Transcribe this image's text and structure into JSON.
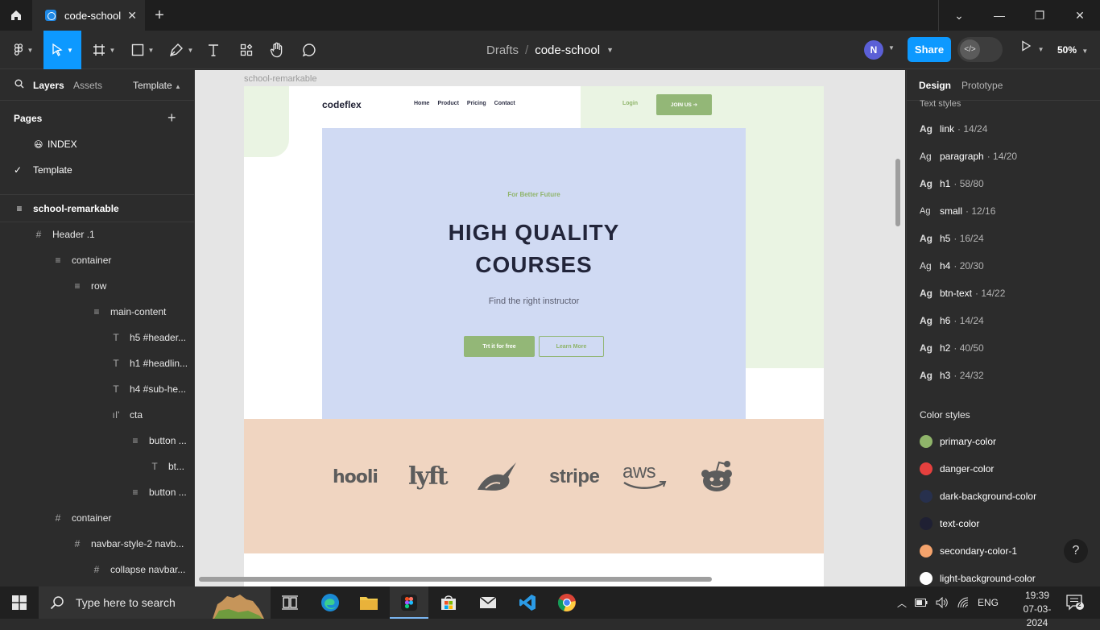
{
  "browser": {
    "tab_title": "code-school",
    "tab_close": "✕",
    "new_tab": "+",
    "win_minimize": "—",
    "win_restore": "❐",
    "win_close": "✕"
  },
  "toolbar": {
    "breadcrumb_parent": "Drafts",
    "breadcrumb_sep": "/",
    "file_name": "code-school",
    "avatar_initial": "N",
    "share_label": "Share",
    "zoom_label": "50%"
  },
  "left_panel": {
    "tabs": [
      "Layers",
      "Assets",
      "Template"
    ],
    "pages_header": "Pages",
    "pages": [
      {
        "emoji": "😃",
        "name": "INDEX"
      },
      {
        "check": "✓",
        "name": "Template"
      }
    ],
    "layers": [
      {
        "name": "school-remarkable",
        "icon": "≡"
      },
      {
        "name": "Header .1",
        "icon": "#"
      },
      {
        "name": "container",
        "icon": "≡"
      },
      {
        "name": "row",
        "icon": "≡"
      },
      {
        "name": "main-content",
        "icon": "≡"
      },
      {
        "name": "h5 #header...",
        "icon": "T"
      },
      {
        "name": "h1 #headlin...",
        "icon": "T"
      },
      {
        "name": "h4 #sub-he...",
        "icon": "T"
      },
      {
        "name": "cta",
        "icon": "ıI'"
      },
      {
        "name": "button ...",
        "icon": "≡"
      },
      {
        "name": "bt...",
        "icon": "T"
      },
      {
        "name": "button ...",
        "icon": "≡"
      },
      {
        "name": "container",
        "icon": "#"
      },
      {
        "name": "navbar-style-2 navb...",
        "icon": "#"
      },
      {
        "name": "collapse navbar...",
        "icon": "#"
      }
    ]
  },
  "canvas": {
    "frame_label": "school-remarkable",
    "site": {
      "logo": "codeflex",
      "nav": [
        "Home",
        "Product",
        "Pricing",
        "Contact"
      ],
      "login": "Login",
      "join": "JOIN US  ➔",
      "hero_tag": "For Better Future",
      "hero_title_line1": "HIGH QUALITY",
      "hero_title_line2": "COURSES",
      "hero_sub": "Find the right instructor",
      "btn_primary": "Trt it for free",
      "btn_secondary": "Learn More",
      "brands": [
        "hooli",
        "lyft",
        "stripe",
        "aws"
      ]
    }
  },
  "right_panel": {
    "tabs": [
      "Design",
      "Prototype"
    ],
    "text_styles_header": "Text styles",
    "text_styles": [
      {
        "ag": "Ag",
        "name": "link",
        "meta": "· 14/24"
      },
      {
        "ag": "Ag",
        "name": "paragraph",
        "meta": "· 14/20"
      },
      {
        "ag": "Ag",
        "name": "h1",
        "meta": "· 58/80"
      },
      {
        "ag": "Ag",
        "name": "small",
        "meta": "· 12/16"
      },
      {
        "ag": "Ag",
        "name": "h5",
        "meta": "· 16/24"
      },
      {
        "ag": "Ag",
        "name": "h4",
        "meta": "· 20/30"
      },
      {
        "ag": "Ag",
        "name": "btn-text",
        "meta": "· 14/22"
      },
      {
        "ag": "Ag",
        "name": "h6",
        "meta": "· 14/24"
      },
      {
        "ag": "Ag",
        "name": "h2",
        "meta": "· 40/50"
      },
      {
        "ag": "Ag",
        "name": "h3",
        "meta": "· 24/32"
      }
    ],
    "color_styles_header": "Color styles",
    "color_styles": [
      {
        "name": "primary-color",
        "color": "#8fb46a"
      },
      {
        "name": "danger-color",
        "color": "#e5403e"
      },
      {
        "name": "dark-background-color",
        "color": "#27304d"
      },
      {
        "name": "text-color",
        "color": "#1f2033"
      },
      {
        "name": "secondary-color-1",
        "color": "#f4a36c"
      },
      {
        "name": "light-background-color",
        "color": "#ffffff"
      }
    ],
    "help": "?"
  },
  "taskbar": {
    "search_placeholder": "Type here to search",
    "lang": "ENG",
    "time": "19:39",
    "date": "07-03-2024",
    "notifications": "2"
  },
  "colors": {
    "accent": "#0d99ff",
    "primary_green": "#93b777",
    "hero_bg": "#d0daf3",
    "logo_band": "#f0d5c1"
  }
}
